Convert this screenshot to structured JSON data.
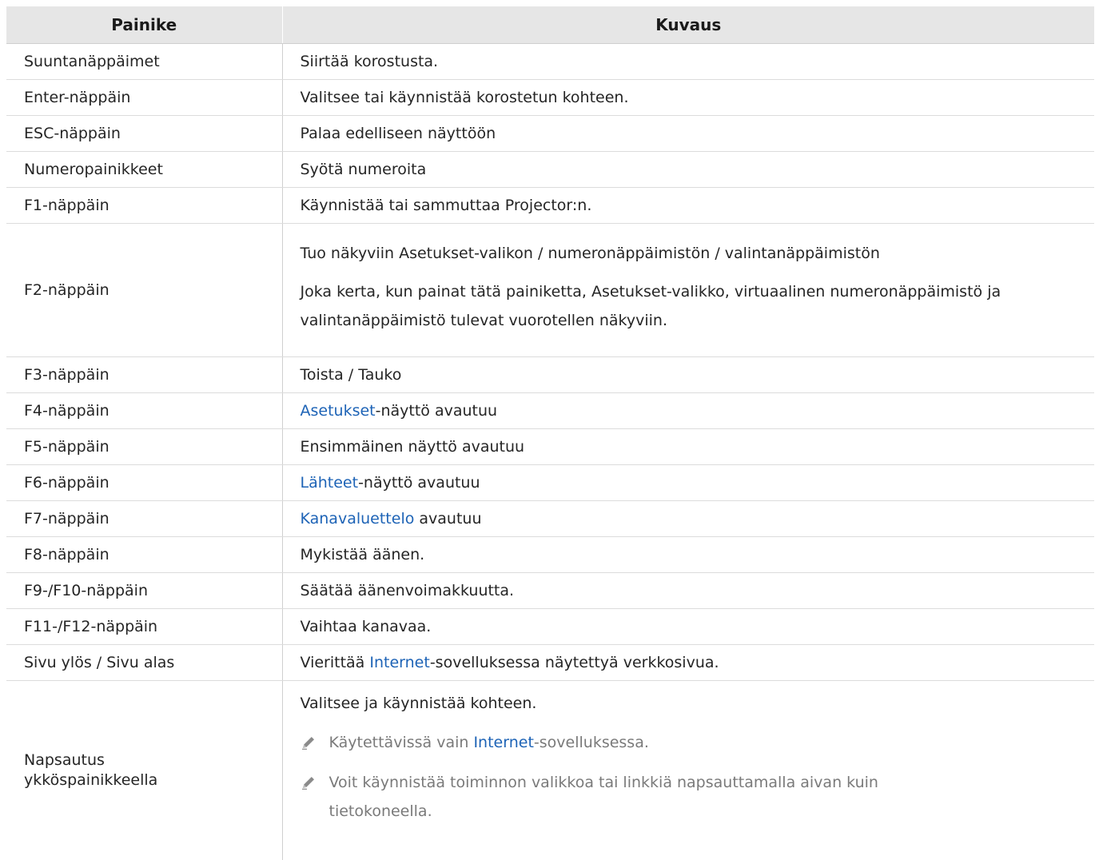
{
  "table": {
    "headers": [
      "Painike",
      "Kuvaus"
    ],
    "rows": [
      {
        "key": "Suuntanäppäimet",
        "desc": "Siirtää korostusta."
      },
      {
        "key": "Enter-näppäin",
        "desc": "Valitsee tai käynnistää korostetun kohteen."
      },
      {
        "key": "ESC-näppäin",
        "desc": "Palaa edelliseen näyttöön"
      },
      {
        "key": "Numeropainikkeet",
        "desc": "Syötä numeroita"
      },
      {
        "key": "F1-näppäin",
        "desc": "Käynnistää tai sammuttaa Projector:n."
      },
      {
        "key": "F2-näppäin",
        "desc": "Tuo näkyviin Asetukset-valikon / numeronäppäimistön / valintanäppäimistön",
        "desc2": "Joka kerta, kun painat tätä painiketta, Asetukset-valikko, virtuaalinen numeronäppäimistö ja valintanäppäimistö tulevat vuorotellen näkyviin."
      },
      {
        "key": "F3-näppäin",
        "desc": "Toista / Tauko"
      },
      {
        "key": "F4-näppäin",
        "desc_link": "Asetukset",
        "desc_rest": "-näyttö avautuu"
      },
      {
        "key": "F5-näppäin",
        "desc": "Ensimmäinen näyttö avautuu"
      },
      {
        "key": "F6-näppäin",
        "desc_link": "Lähteet",
        "desc_rest": "-näyttö avautuu"
      },
      {
        "key": "F7-näppäin",
        "desc_link": "Kanavaluettelo",
        "desc_rest": " avautuu"
      },
      {
        "key": "F8-näppäin",
        "desc": "Mykistää äänen."
      },
      {
        "key": "F9-/F10-näppäin",
        "desc": "Säätää äänenvoimakkuutta."
      },
      {
        "key": "F11-/F12-näppäin",
        "desc": "Vaihtaa kanavaa."
      },
      {
        "key": "Sivu ylös / Sivu alas",
        "desc_pre": "Vierittää ",
        "desc_link": "Internet",
        "desc_rest": "-sovelluksessa näytettyä verkkosivua."
      },
      {
        "key_line1": "Napsautus",
        "key_line2": "ykköspainikkeella",
        "desc": "Valitsee ja käynnistää kohteen.",
        "note1_pre": "Käytettävissä vain ",
        "note1_link": "Internet",
        "note1_rest": "-sovelluksessa.",
        "note2": "Voit käynnistää toiminnon valikkoa tai linkkiä napsauttamalla aivan kuin tietokoneella.",
        "note_icon": "pencil-icon"
      }
    ]
  },
  "colors": {
    "header_bg": "#e6e6e6",
    "link": "#1d63b6",
    "note_text": "#7a7a7a"
  }
}
